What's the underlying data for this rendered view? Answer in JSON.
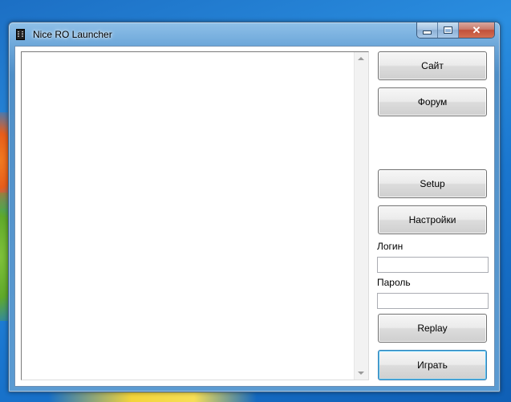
{
  "window": {
    "title": "Nice RO Launcher",
    "close_glyph": "✕"
  },
  "buttons": {
    "site": "Сайт",
    "forum": "Форум",
    "setup": "Setup",
    "settings": "Настройки",
    "replay": "Replay",
    "play": "Играть"
  },
  "login": {
    "label": "Логин",
    "value": ""
  },
  "password": {
    "label": "Пароль",
    "value": ""
  },
  "log": {
    "content": ""
  },
  "colors": {
    "accent_focus": "#3c7fb1",
    "close_button": "#c2503a"
  }
}
